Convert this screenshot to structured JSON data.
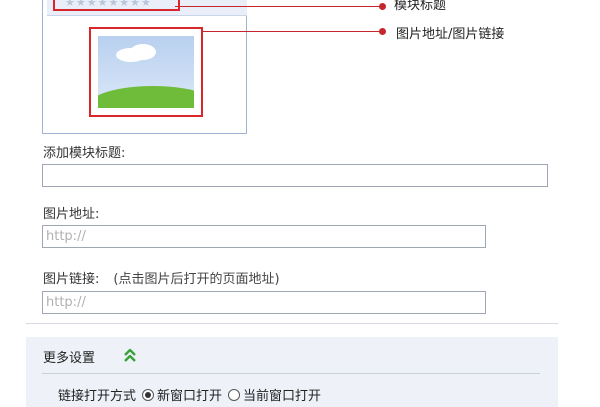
{
  "preview": {
    "title_placeholder_stars": "★★★★★★★★",
    "callouts": {
      "module_title": "模块标题",
      "image_link": "图片地址/图片链接"
    }
  },
  "form": {
    "module_title_label": "添加模块标题:",
    "module_title_value": "",
    "image_url_label": "图片地址:",
    "image_url_placeholder": "http://",
    "image_link_label": "图片链接:",
    "image_link_hint": "(点击图片后打开的页面地址)",
    "image_link_placeholder": "http://"
  },
  "settings": {
    "title": "更多设置",
    "expand_icon": "double-chevron-up-icon",
    "open_mode_label": "链接打开方式",
    "options": [
      {
        "label": "新窗口打开",
        "checked": true
      },
      {
        "label": "当前窗口打开",
        "checked": false
      }
    ]
  },
  "colors": {
    "callout_red": "#c4262b",
    "panel_border": "#9cb3d3",
    "settings_bg": "#eef2f8",
    "expand_icon_green": "#3aa23a"
  }
}
